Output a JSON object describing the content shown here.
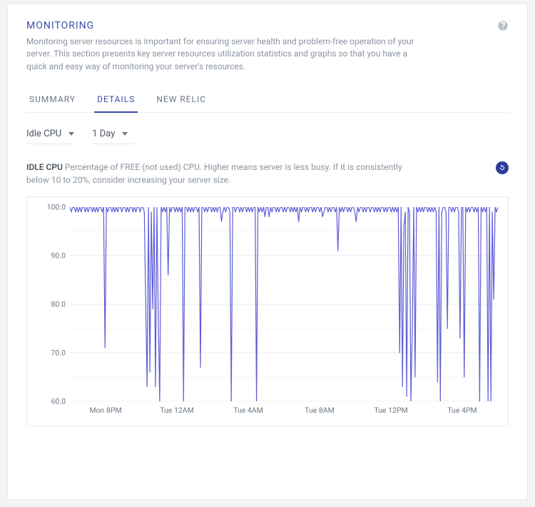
{
  "header": {
    "title": "MONITORING",
    "description": "Monitoring server resources is important for ensuring server health and problem-free operation of your server. This section presents key server resources utilization statistics and graphs so that you have a quick and easy way of monitoring your server's resources."
  },
  "tabs": [
    "SUMMARY",
    "DETAILS",
    "NEW RELIC"
  ],
  "active_tab": 1,
  "selectors": {
    "metric": {
      "label": "Idle CPU"
    },
    "range": {
      "label": "1 Day"
    }
  },
  "metric": {
    "name": "IDLE CPU",
    "hint": "Percentage of FREE (not used) CPU. Higher means server is less busy. If it is consistently below 10 to 20%, consider increasing your server size."
  },
  "chart_data": {
    "type": "line",
    "title": "IDLE CPU",
    "xlabel": "",
    "ylabel": "",
    "ylim": [
      60,
      100
    ],
    "y_ticks": [
      100.0,
      90.0,
      80.0,
      70.0,
      60.0
    ],
    "x_categories": [
      "Mon 8PM",
      "Tue 12AM",
      "Tue 4AM",
      "Tue 8AM",
      "Tue 12PM",
      "Tue 4PM"
    ],
    "series": [
      {
        "name": "Idle CPU %",
        "color": "#5d5cd6",
        "values": [
          100,
          99,
          100,
          100,
          99,
          100,
          99,
          100,
          99,
          100,
          100,
          99,
          100,
          99,
          100,
          100,
          99,
          100,
          99,
          100,
          99,
          100,
          100,
          99,
          100,
          71,
          100,
          99,
          100,
          100,
          99,
          100,
          99,
          100,
          99,
          100,
          100,
          99,
          100,
          100,
          99,
          100,
          99,
          100,
          100,
          99,
          100,
          99,
          100,
          100,
          99,
          100,
          100,
          99,
          81,
          63,
          100,
          66,
          99,
          79,
          100,
          63,
          100,
          77,
          60,
          100,
          99,
          100,
          99,
          100,
          86,
          100,
          99,
          100,
          100,
          99,
          100,
          99,
          100,
          99,
          100,
          60,
          100,
          100,
          99,
          100,
          99,
          100,
          99,
          100,
          100,
          99,
          100,
          67,
          100,
          100,
          99,
          100,
          99,
          100,
          100,
          99,
          100,
          99,
          100,
          99,
          100,
          100,
          97,
          99,
          100,
          99,
          100,
          100,
          99,
          60,
          100,
          100,
          99,
          100,
          100,
          99,
          100,
          99,
          100,
          100,
          99,
          100,
          99,
          100,
          99,
          100,
          100,
          60,
          100,
          99,
          100,
          99,
          100,
          98,
          100,
          100,
          98,
          100,
          99,
          100,
          100,
          99,
          100,
          99,
          100,
          100,
          99,
          100,
          99,
          100,
          100,
          99,
          100,
          99,
          100,
          99,
          100,
          97,
          100,
          99,
          100,
          100,
          99,
          100,
          99,
          100,
          100,
          99,
          100,
          99,
          100,
          100,
          99,
          100,
          98,
          99,
          100,
          100,
          99,
          100,
          99,
          100,
          100,
          99,
          100,
          91,
          100,
          99,
          100,
          99,
          100,
          100,
          99,
          100,
          99,
          100,
          100,
          99,
          97,
          100,
          99,
          100,
          100,
          99,
          100,
          99,
          100,
          100,
          99,
          100,
          100,
          99,
          100,
          99,
          100,
          99,
          100,
          100,
          99,
          100,
          99,
          100,
          100,
          99,
          100,
          99,
          100,
          99,
          100,
          70,
          100,
          63,
          96,
          99,
          61,
          100,
          99,
          60,
          75,
          100,
          65,
          100,
          99,
          100,
          99,
          100,
          99,
          100,
          100,
          99,
          100,
          99,
          100,
          99,
          100,
          99,
          64,
          100,
          60,
          99,
          100,
          100,
          99,
          75,
          100,
          100,
          99,
          100,
          99,
          100,
          100,
          99,
          73,
          100,
          100,
          65,
          100,
          99,
          100,
          99,
          100,
          100,
          99,
          100,
          99,
          100,
          60,
          100,
          99,
          100,
          99,
          100,
          60,
          100,
          60,
          99,
          81,
          100,
          99,
          100
        ]
      }
    ]
  }
}
